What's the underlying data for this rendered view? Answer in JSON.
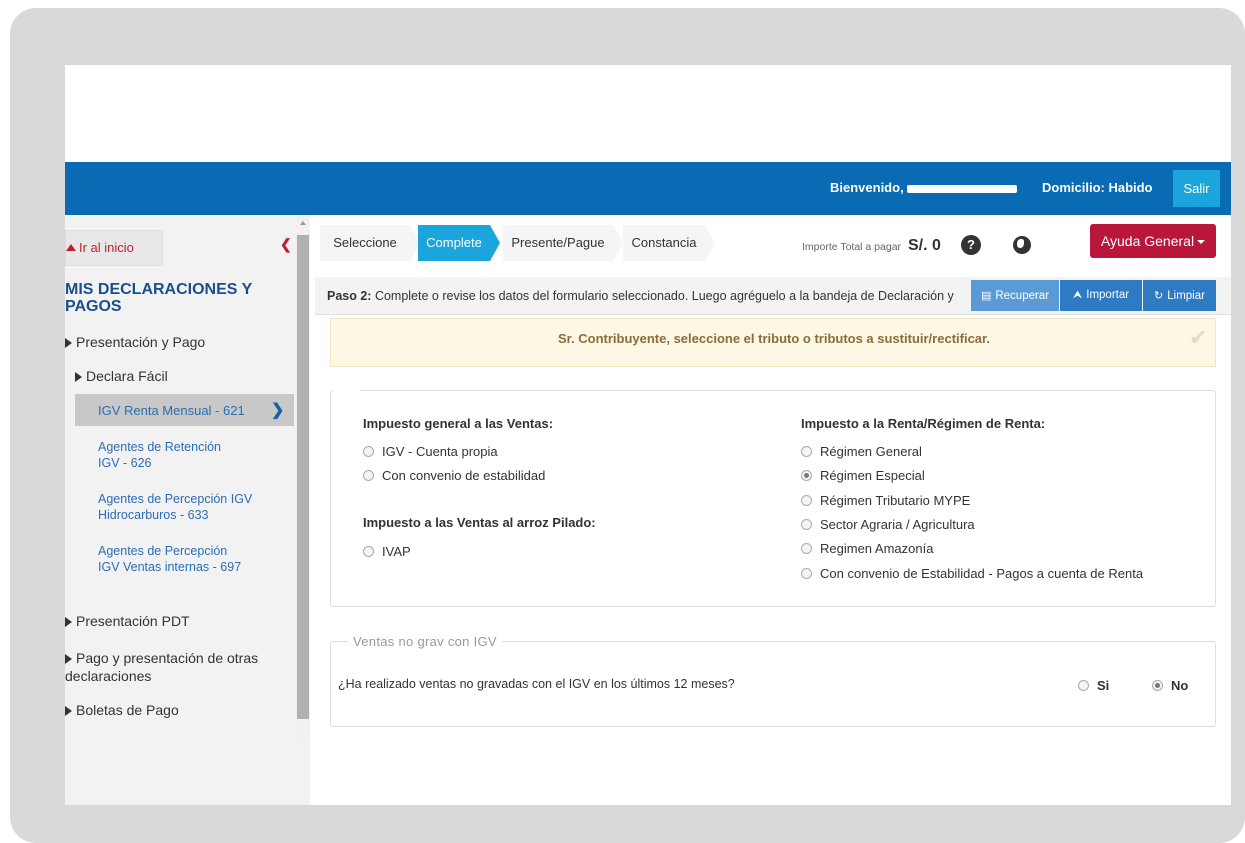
{
  "header": {
    "welcome_label": "Bienvenido,",
    "domicilio_label": "Domicilio: Habido",
    "logout_label": "Salir"
  },
  "sidebar": {
    "home_label": "Ir al inicio",
    "title": "MIS DECLARACIONES Y PAGOS",
    "section_presentacion": "Presentación y Pago",
    "section_declara": "Declara Fácil",
    "active_item": "IGV Renta Mensual - 621",
    "items": [
      {
        "label": "Agentes de Retención IGV - 626"
      },
      {
        "label": "Agentes de Percepción IGV Hidrocarburos - 633"
      },
      {
        "label": "Agentes de Percepción IGV Ventas internas - 697"
      }
    ],
    "section_pdt": "Presentación PDT",
    "section_otras": "Pago y presentación de otras declaraciones",
    "section_boletas": "Boletas de Pago"
  },
  "steps": [
    {
      "label": "Seleccione",
      "active": false
    },
    {
      "label": "Complete",
      "active": true
    },
    {
      "label": "Presente/Pague",
      "active": false
    },
    {
      "label": "Constancia",
      "active": false
    }
  ],
  "importe": {
    "label": "Importe Total a pagar",
    "value": "S/. 0"
  },
  "help_button": "Ayuda General",
  "paso": {
    "step_label": "Paso 2:",
    "text": " Complete o revise los datos del formulario seleccionado. Luego agréguelo a la bandeja de Declaración y"
  },
  "toolbar": {
    "recuperar": "Recuperar",
    "importar": "Importar",
    "limpiar": "Limpiar"
  },
  "alert": {
    "text": "Sr. Contribuyente, seleccione el tributo o tributos a sustituir/rectificar."
  },
  "igv_section": {
    "title": "Impuesto general a las Ventas:",
    "options": [
      {
        "label": "IGV - Cuenta propia",
        "checked": false
      },
      {
        "label": "Con convenio de estabilidad",
        "checked": false
      }
    ]
  },
  "ivap_section": {
    "title": "Impuesto a las Ventas al arroz Pilado:",
    "options": [
      {
        "label": "IVAP",
        "checked": false
      }
    ]
  },
  "renta_section": {
    "title": "Impuesto a la Renta/Régimen de Renta:",
    "options": [
      {
        "label": "Régimen General",
        "checked": false
      },
      {
        "label": "Régimen Especial",
        "checked": true
      },
      {
        "label": "Régimen Tributario MYPE",
        "checked": false
      },
      {
        "label": "Sector Agraria / Agricultura",
        "checked": false
      },
      {
        "label": "Regimen Amazonía",
        "checked": false
      },
      {
        "label": "Con convenio de Estabilidad - Pagos a cuenta de Renta",
        "checked": false
      }
    ]
  },
  "ventas_section": {
    "legend": "Ventas no grav con IGV",
    "question": "¿Ha realizado ventas no gravadas con el IGV en los últimos 12 meses?",
    "yes_label": "Si",
    "no_label": "No",
    "selected": "No"
  },
  "colors": {
    "topbar": "#0a6ab4",
    "active_step": "#1aa5dd",
    "help_button": "#b8163a",
    "toolbar_button": "#2e7bc4"
  }
}
